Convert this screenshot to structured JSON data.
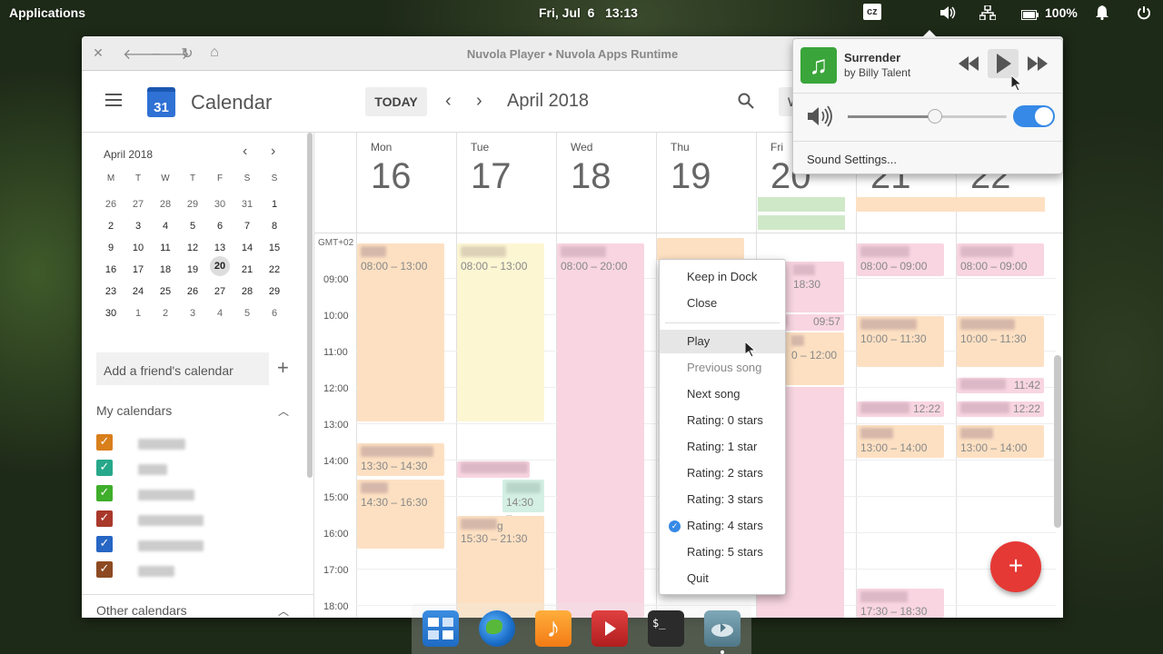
{
  "panel": {
    "applications": "Applications",
    "clock": "Fri, Jul  6   13:13",
    "keyboard": "cz",
    "battery": "100%"
  },
  "window": {
    "title": "Nuvola Player • Nuvola Apps Runtime"
  },
  "calendar": {
    "logo_num": "31",
    "app_name": "Calendar",
    "today": "TODAY",
    "month": "April 2018",
    "view_letter": "W",
    "mini": {
      "title": "April 2018",
      "dows": [
        "M",
        "T",
        "W",
        "T",
        "F",
        "S",
        "S"
      ],
      "weeks": [
        [
          "26",
          "27",
          "28",
          "29",
          "30",
          "31",
          "1"
        ],
        [
          "2",
          "3",
          "4",
          "5",
          "6",
          "7",
          "8"
        ],
        [
          "9",
          "10",
          "11",
          "12",
          "13",
          "14",
          "15"
        ],
        [
          "16",
          "17",
          "18",
          "19",
          "20",
          "21",
          "22"
        ],
        [
          "23",
          "24",
          "25",
          "26",
          "27",
          "28",
          "29"
        ],
        [
          "30",
          "1",
          "2",
          "3",
          "4",
          "5",
          "6"
        ]
      ]
    },
    "friend_placeholder": "Add a friend's calendar",
    "my_calendars": "My calendars",
    "other_calendars": "Other calendars",
    "days": [
      {
        "dow": "Mon",
        "num": "16"
      },
      {
        "dow": "Tue",
        "num": "17"
      },
      {
        "dow": "Wed",
        "num": "18"
      },
      {
        "dow": "Thu",
        "num": "19"
      },
      {
        "dow": "Fri",
        "num": "20"
      },
      {
        "dow": "",
        "num": "21"
      },
      {
        "dow": "",
        "num": "22"
      }
    ],
    "tz": "GMT+02",
    "hours": [
      "09:00",
      "10:00",
      "11:00",
      "12:00",
      "13:00",
      "14:00",
      "15:00",
      "16:00",
      "17:00",
      "18:00"
    ],
    "events": {
      "e1": "08:00 – 13:00",
      "e2": "08:00 – 13:00",
      "e3": "08:00 – 20:00",
      "e4": "13:30 – 14:30",
      "e5": "14:30 – 16:30",
      "e6": "14:30 –",
      "e7": "15:30 – 21:30",
      "e8": "18:30",
      "e9": "09:57",
      "e10": "0 – 12:00",
      "e11": "08:00 – 09:00",
      "e12": "08:00 – 09:00",
      "e13": "10:00 – 11:30",
      "e14": "10:00 – 11:30",
      "e15": "11:42",
      "e16": "12:22",
      "e17": "12:22",
      "e18": "13:00 – 14:00",
      "e19": "13:00 – 14:00",
      "e20": "17:30 – 18:30",
      "e21": "g"
    }
  },
  "menu": {
    "items": [
      "Keep in Dock",
      "Close",
      "Play",
      "Previous song",
      "Next song",
      "Rating: 0 stars",
      "Rating: 1 star",
      "Rating: 2 stars",
      "Rating: 3 stars",
      "Rating: 4 stars",
      "Rating: 5 stars",
      "Quit"
    ],
    "checked": "Rating: 4 stars",
    "disabled": "Previous song",
    "hovered": "Play"
  },
  "sound": {
    "track": "Surrender",
    "artist": "by Billy Talent",
    "settings": "Sound Settings...",
    "volume": 0.55,
    "enabled": true
  },
  "dock": {
    "apps": [
      "multitasking-view-icon",
      "web-browser-icon",
      "music-icon",
      "videos-icon",
      "terminal-icon",
      "nuvola-player-icon"
    ]
  },
  "colors": {
    "accent": "#3689e6",
    "fab": "#e53935",
    "orange_event": "#fde0c2",
    "yellow_event": "#fdf6d3",
    "pink_event": "#f8d5e1",
    "green_event": "#d4efe4"
  }
}
